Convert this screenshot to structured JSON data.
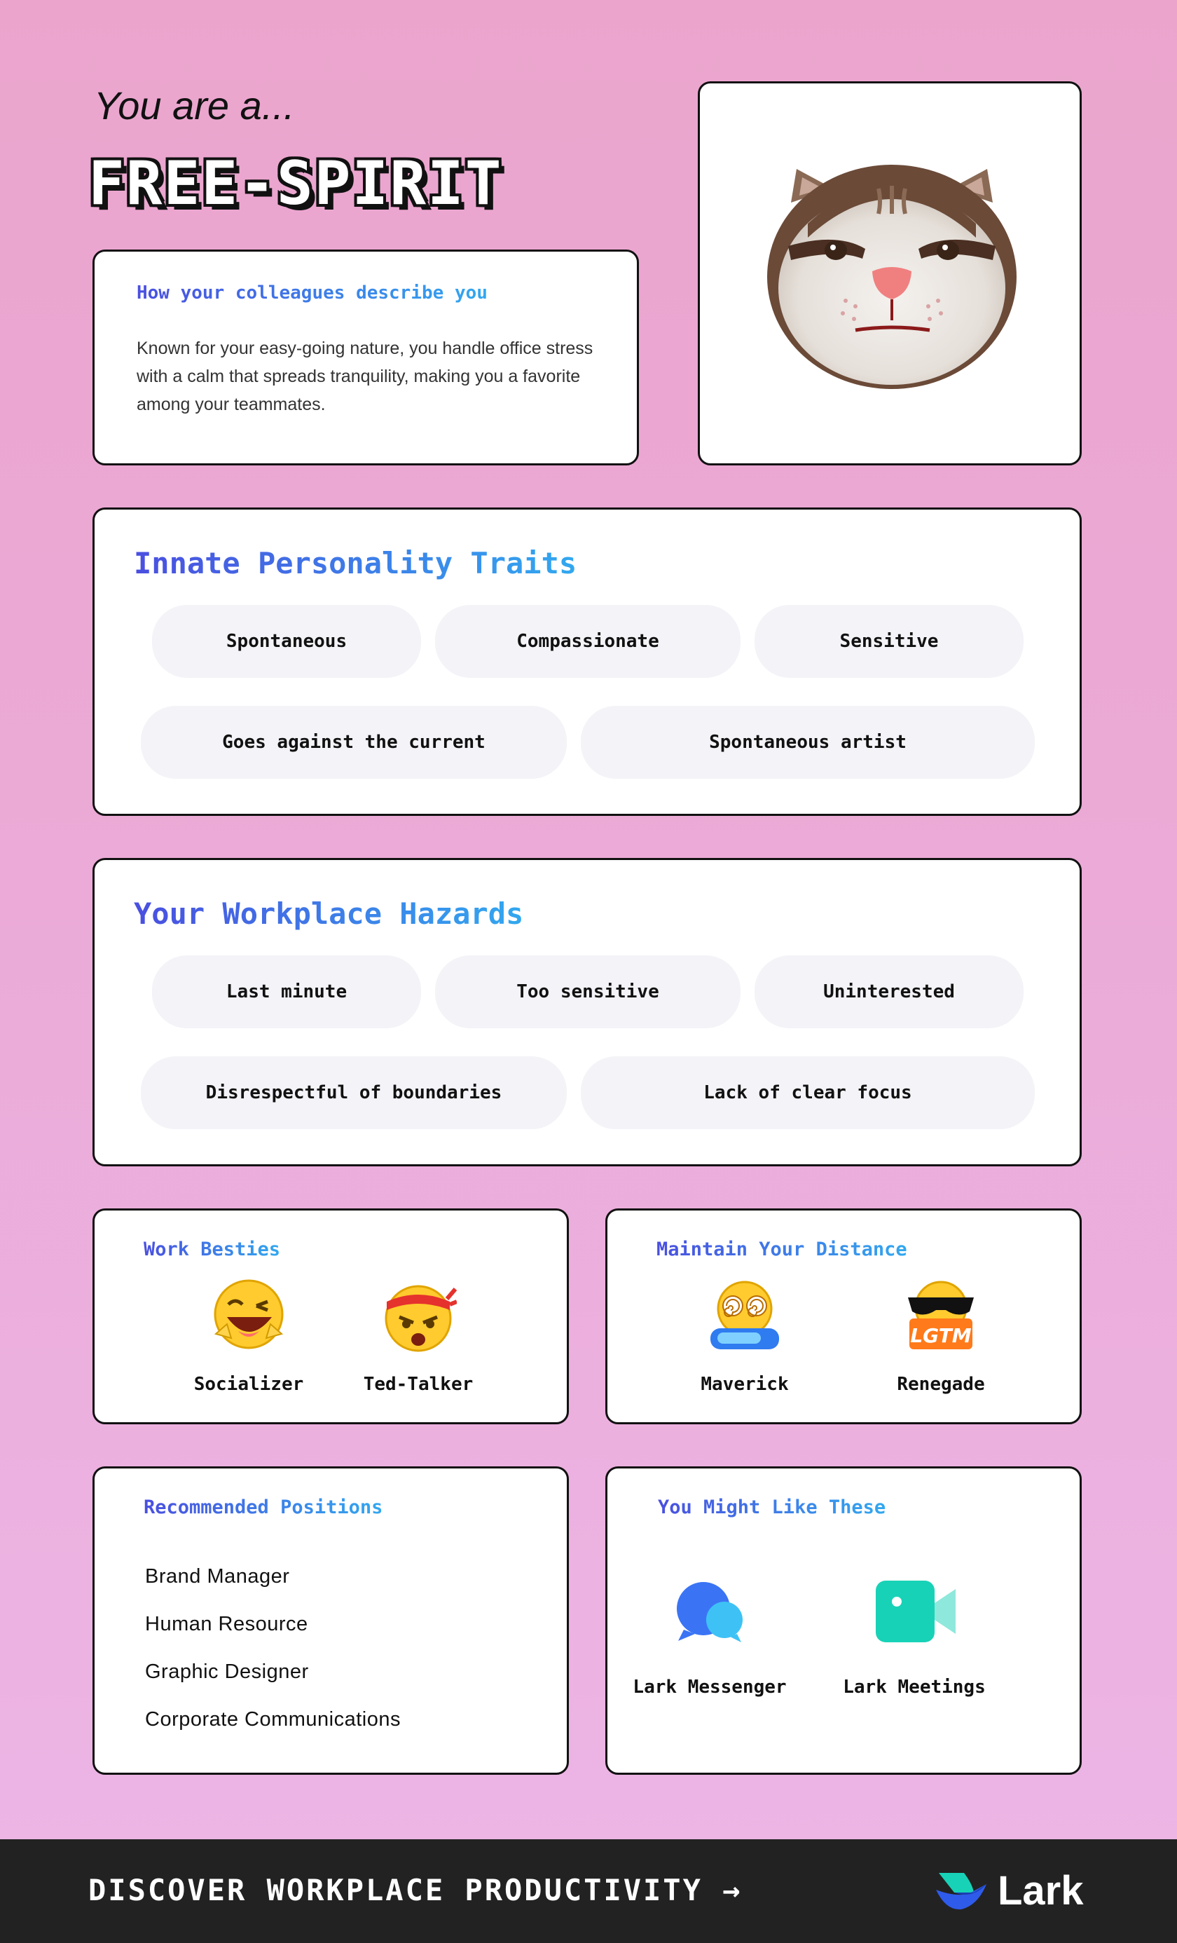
{
  "intro": "You are a...",
  "type_title": "FREE-SPIRIT",
  "description": {
    "title": "How your colleagues describe you",
    "body": "Known for your easy-going nature, you handle office stress with a calm that spreads tranquility, making you a favorite among your teammates."
  },
  "avatar_icon": "cat-face-icon",
  "traits": {
    "title": "Innate Personality Traits",
    "items": [
      "Spontaneous",
      "Compassionate",
      "Sensitive",
      "Goes against the current",
      "Spontaneous artist"
    ]
  },
  "hazards": {
    "title": "Your Workplace Hazards",
    "items": [
      "Last minute",
      "Too sensitive",
      "Uninterested",
      "Disrespectful of boundaries",
      "Lack of clear focus"
    ]
  },
  "besties": {
    "title": "Work Besties",
    "items": [
      {
        "label": "Socializer",
        "icon": "laughing-wink-emoji-icon"
      },
      {
        "label": "Ted-Talker",
        "icon": "headband-shouting-emoji-icon"
      }
    ]
  },
  "distance": {
    "title": "Maintain Your Distance",
    "items": [
      {
        "label": "Maverick",
        "icon": "dizzy-eyes-emoji-icon"
      },
      {
        "label": "Renegade",
        "icon": "sunglasses-lgtm-emoji-icon"
      }
    ],
    "lgtm_text": "LGTM"
  },
  "positions": {
    "title": "Recommended Positions",
    "items": [
      "Brand Manager",
      "Human Resource",
      "Graphic Designer",
      "Corporate Communications"
    ]
  },
  "apps": {
    "title": "You Might Like These",
    "items": [
      {
        "label": "Lark Messenger",
        "icon": "messenger-bubbles-icon"
      },
      {
        "label": "Lark Meetings",
        "icon": "video-camera-icon"
      }
    ]
  },
  "footer": {
    "cta": "DISCOVER WORKPLACE PRODUCTIVITY →",
    "brand": "Lark"
  },
  "colors": {
    "accent_start": "#4a4fe0",
    "accent_end": "#32a8ef",
    "pill_bg": "#f3f3f8",
    "footer_bg": "#222222"
  }
}
